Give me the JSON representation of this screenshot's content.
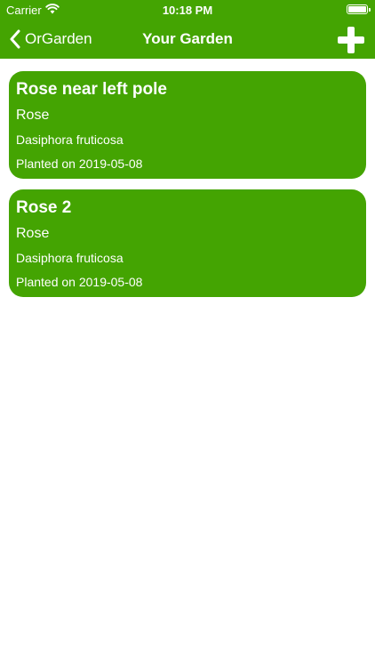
{
  "status_bar": {
    "carrier": "Carrier",
    "time": "10:18 PM",
    "icons": [
      "wifi-icon",
      "battery-icon"
    ]
  },
  "nav": {
    "back_label": "OrGarden",
    "title": "Your Garden",
    "back_icon": "chevron-left-icon",
    "add_icon": "plus-icon"
  },
  "colors": {
    "accent": "#44a402",
    "background": "#ffffff",
    "text_on_accent": "#ffffff"
  },
  "plants": [
    {
      "name": "Rose near left pole",
      "common": "Rose",
      "species": "Dasiphora fruticosa",
      "planted": "Planted on 2019-05-08"
    },
    {
      "name": "Rose 2",
      "common": "Rose",
      "species": "Dasiphora fruticosa",
      "planted": "Planted on 2019-05-08"
    }
  ]
}
